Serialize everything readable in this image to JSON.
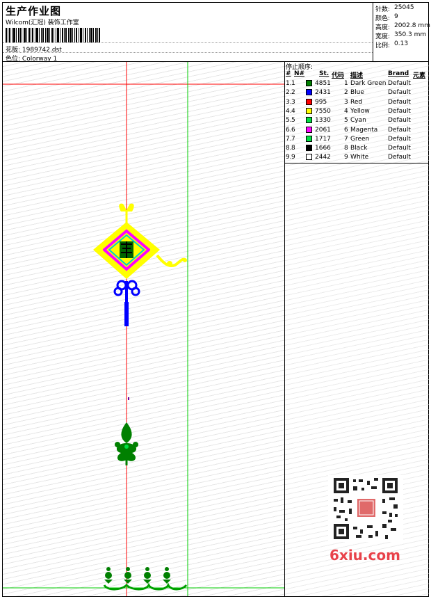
{
  "header": {
    "title": "生产作业图",
    "company": "Wilcom(汇冠) 装饰工作室",
    "design_label": "花版:",
    "design_file": "1989742.dst",
    "colorway_label": "色位:",
    "colorway": "Colorway 1"
  },
  "stats": [
    {
      "label": "针数:",
      "value": "25045"
    },
    {
      "label": "颜色:",
      "value": "9"
    },
    {
      "label": "高度:",
      "value": "2002.8 mm"
    },
    {
      "label": "宽度:",
      "value": "350.3 mm"
    },
    {
      "label": "比例:",
      "value": "0.13"
    }
  ],
  "stop_sequence": {
    "title": "停止顺序:",
    "columns": [
      "#",
      "N#",
      "St.",
      "代码",
      "描述",
      "Brand",
      "元素"
    ],
    "rows": [
      {
        "num": "1.",
        "n": "1",
        "color": "#008000",
        "stitches": "4851",
        "code": "1",
        "desc": "Dark Green",
        "brand": "Default"
      },
      {
        "num": "2.",
        "n": "2",
        "color": "#0000ff",
        "stitches": "2431",
        "code": "2",
        "desc": "Blue",
        "brand": "Default"
      },
      {
        "num": "3.",
        "n": "3",
        "color": "#ff0000",
        "stitches": "995",
        "code": "3",
        "desc": "Red",
        "brand": "Default"
      },
      {
        "num": "4.",
        "n": "4",
        "color": "#ffff00",
        "stitches": "7550",
        "code": "4",
        "desc": "Yellow",
        "brand": "Default"
      },
      {
        "num": "5.",
        "n": "5",
        "color": "#00e040",
        "stitches": "1330",
        "code": "5",
        "desc": "Cyan",
        "brand": "Default"
      },
      {
        "num": "6.",
        "n": "6",
        "color": "#ff00ff",
        "stitches": "2061",
        "code": "6",
        "desc": "Magenta",
        "brand": "Default"
      },
      {
        "num": "7.",
        "n": "7",
        "color": "#00e040",
        "stitches": "1717",
        "code": "7",
        "desc": "Green",
        "brand": "Default"
      },
      {
        "num": "8.",
        "n": "8",
        "color": "#000000",
        "stitches": "1666",
        "code": "8",
        "desc": "Black",
        "brand": "Default"
      },
      {
        "num": "9.",
        "n": "9",
        "color": "#ffffff",
        "stitches": "2442",
        "code": "9",
        "desc": "White",
        "brand": "Default"
      }
    ]
  },
  "watermark": {
    "site": "6xiu.com"
  },
  "colors": {
    "guide_red": "#ff0000",
    "guide_green": "#00cc00",
    "accent_watermark": "#e8424a"
  }
}
